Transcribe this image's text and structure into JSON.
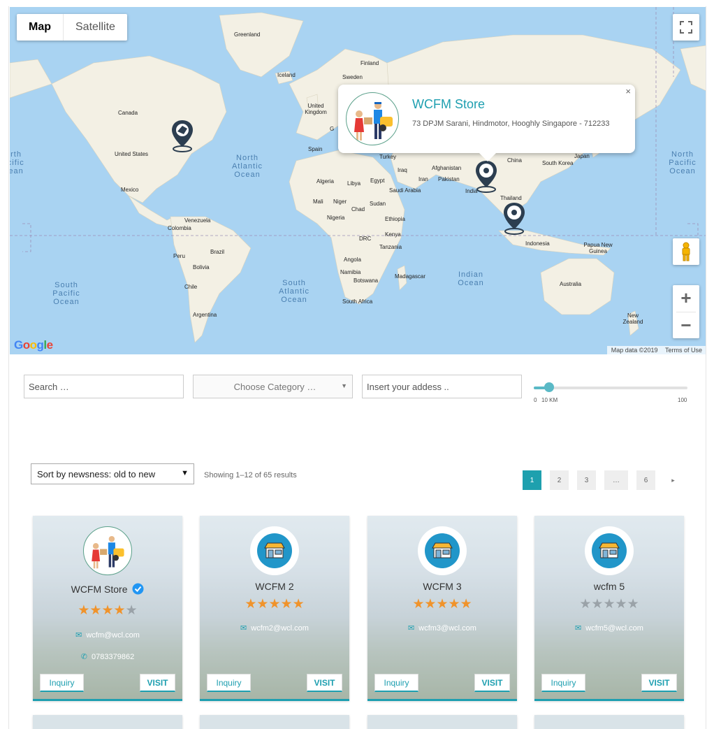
{
  "map": {
    "type_buttons": [
      "Map",
      "Satellite"
    ],
    "countries": [
      "Greenland",
      "Iceland",
      "Finland",
      "Sweden",
      "United Kingdom",
      "Germany",
      "Spain",
      "Canada",
      "United States",
      "Mexico",
      "Venezuela",
      "Colombia",
      "Peru",
      "Brazil",
      "Bolivia",
      "Chile",
      "Argentina",
      "Algeria",
      "Libya",
      "Egypt",
      "Mali",
      "Niger",
      "Chad",
      "Sudan",
      "Nigeria",
      "Ethiopia",
      "DRC",
      "Kenya",
      "Tanzania",
      "Angola",
      "Namibia",
      "Botswana",
      "South Africa",
      "Madagascar",
      "Turkey",
      "Iraq",
      "Iran",
      "Afghanistan",
      "Pakistan",
      "India",
      "China",
      "South Korea",
      "Japan",
      "Saudi Arabia",
      "Thailand",
      "Indonesia",
      "Papua New Guinea",
      "Australia",
      "New Zealand"
    ],
    "oceans": {
      "north_atlantic": "North Atlantic Ocean",
      "south_atlantic": "South Atlantic Ocean",
      "south_pacific": "South Pacific Ocean",
      "north_pacific": "North Pacific Ocean",
      "north_pacific_left": "North Pacific Ocean",
      "indian": "Indian Ocean"
    },
    "google_logo": "Google",
    "attribution": {
      "data": "Map data ©2019",
      "terms": "Terms of Use"
    },
    "info_window": {
      "title": "WCFM Store",
      "address": "73 DPJM Sarani, Hindmotor, Hooghly Singapore - 712233",
      "close": "×"
    },
    "zoom_in": "+",
    "zoom_out": "−"
  },
  "filters": {
    "search_placeholder": "Search …",
    "category_placeholder": "Choose Category …",
    "address_placeholder": "Insert your addess ..",
    "radius": {
      "min": "0",
      "value_label": "10 KM",
      "max": "100",
      "value": 10
    }
  },
  "listing": {
    "sort_label": "Sort by newsness: old to new",
    "showing": "Showing 1–12 of 65 results",
    "pages": [
      "1",
      "2",
      "3",
      "…",
      "6"
    ],
    "next": "▸"
  },
  "colors": {
    "accent": "#1e9fb0",
    "star": "#f0932b",
    "map_water": "#a9d3f2",
    "map_land": "#f3f0e4"
  },
  "stores": [
    {
      "name": "WCFM Store",
      "verified": true,
      "rating": 4,
      "email": "wcfm@wcl.com",
      "phone": "0783379862",
      "inquiry": "Inquiry",
      "visit": "VISIT"
    },
    {
      "name": "WCFM 2",
      "verified": false,
      "rating": 5,
      "email": "wcfm2@wcl.com",
      "inquiry": "Inquiry",
      "visit": "VISIT"
    },
    {
      "name": "WCFM 3",
      "verified": false,
      "rating": 5,
      "email": "wcfm3@wcl.com",
      "inquiry": "Inquiry",
      "visit": "VISIT"
    },
    {
      "name": "wcfm 5",
      "verified": false,
      "rating": 0,
      "email": "wcfm5@wcl.com",
      "inquiry": "Inquiry",
      "visit": "VISIT"
    }
  ]
}
